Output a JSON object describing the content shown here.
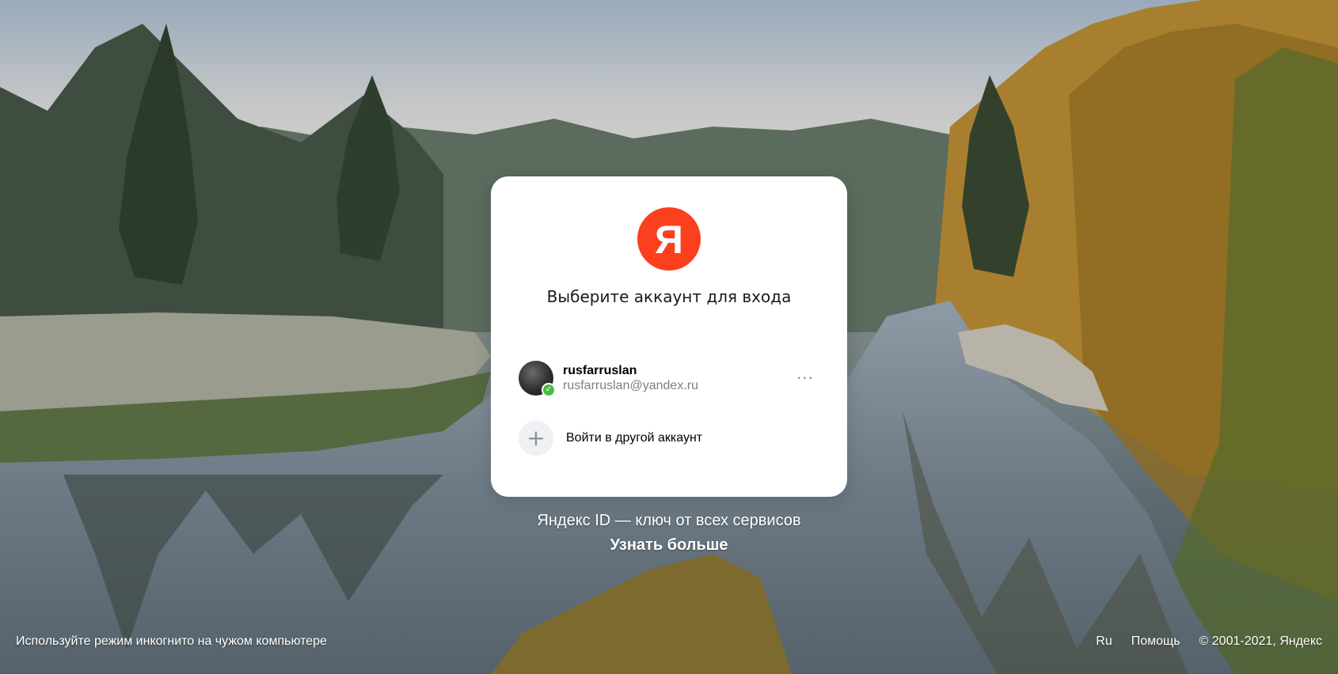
{
  "card": {
    "logo_letter": "Я",
    "title": "Выберите аккаунт для входа",
    "account": {
      "login": "rusfarruslan",
      "email": "rusfarruslan@yandex.ru",
      "more": "···"
    },
    "add_account": {
      "plus": "+",
      "label": "Войти в другой аккаунт"
    }
  },
  "promo": {
    "text": "Яндекс ID — ключ от всех сервисов",
    "link": "Узнать больше"
  },
  "footer": {
    "left": "Используйте режим инкогнито на чужом компьютере",
    "lang": "Ru",
    "help": "Помощь",
    "copyright": "© 2001-2021, Яндекс"
  },
  "colors": {
    "brand_red": "#fc3f1d",
    "check_green": "#4cbb44"
  },
  "icons": {
    "logo": "yandex-logo-icon",
    "verified": "check-icon",
    "more": "ellipsis-icon",
    "add": "plus-icon"
  }
}
